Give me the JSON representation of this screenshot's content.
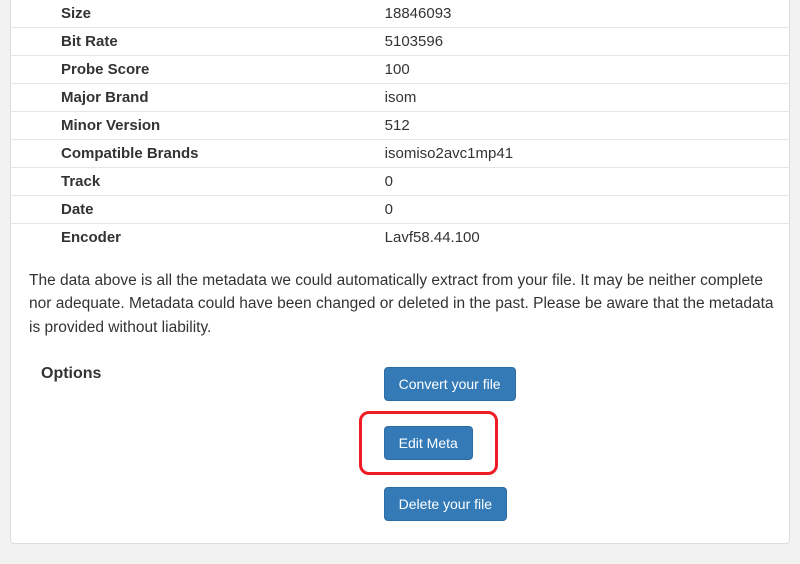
{
  "metadata": {
    "rows": [
      {
        "label": "Size",
        "value": "18846093"
      },
      {
        "label": "Bit Rate",
        "value": "5103596"
      },
      {
        "label": "Probe Score",
        "value": "100"
      },
      {
        "label": "Major Brand",
        "value": "isom"
      },
      {
        "label": "Minor Version",
        "value": "512"
      },
      {
        "label": "Compatible Brands",
        "value": "isomiso2avc1mp41"
      },
      {
        "label": "Track",
        "value": "0"
      },
      {
        "label": "Date",
        "value": "0"
      },
      {
        "label": "Encoder",
        "value": "Lavf58.44.100"
      }
    ]
  },
  "disclaimer": "The data above is all the metadata we could automatically extract from your file. It may be neither complete nor adequate. Metadata could have been changed or deleted in the past. Please be aware that the metadata is provided without liability.",
  "options": {
    "heading": "Options",
    "convert_label": "Convert your file",
    "edit_label": "Edit Meta",
    "delete_label": "Delete your file"
  }
}
